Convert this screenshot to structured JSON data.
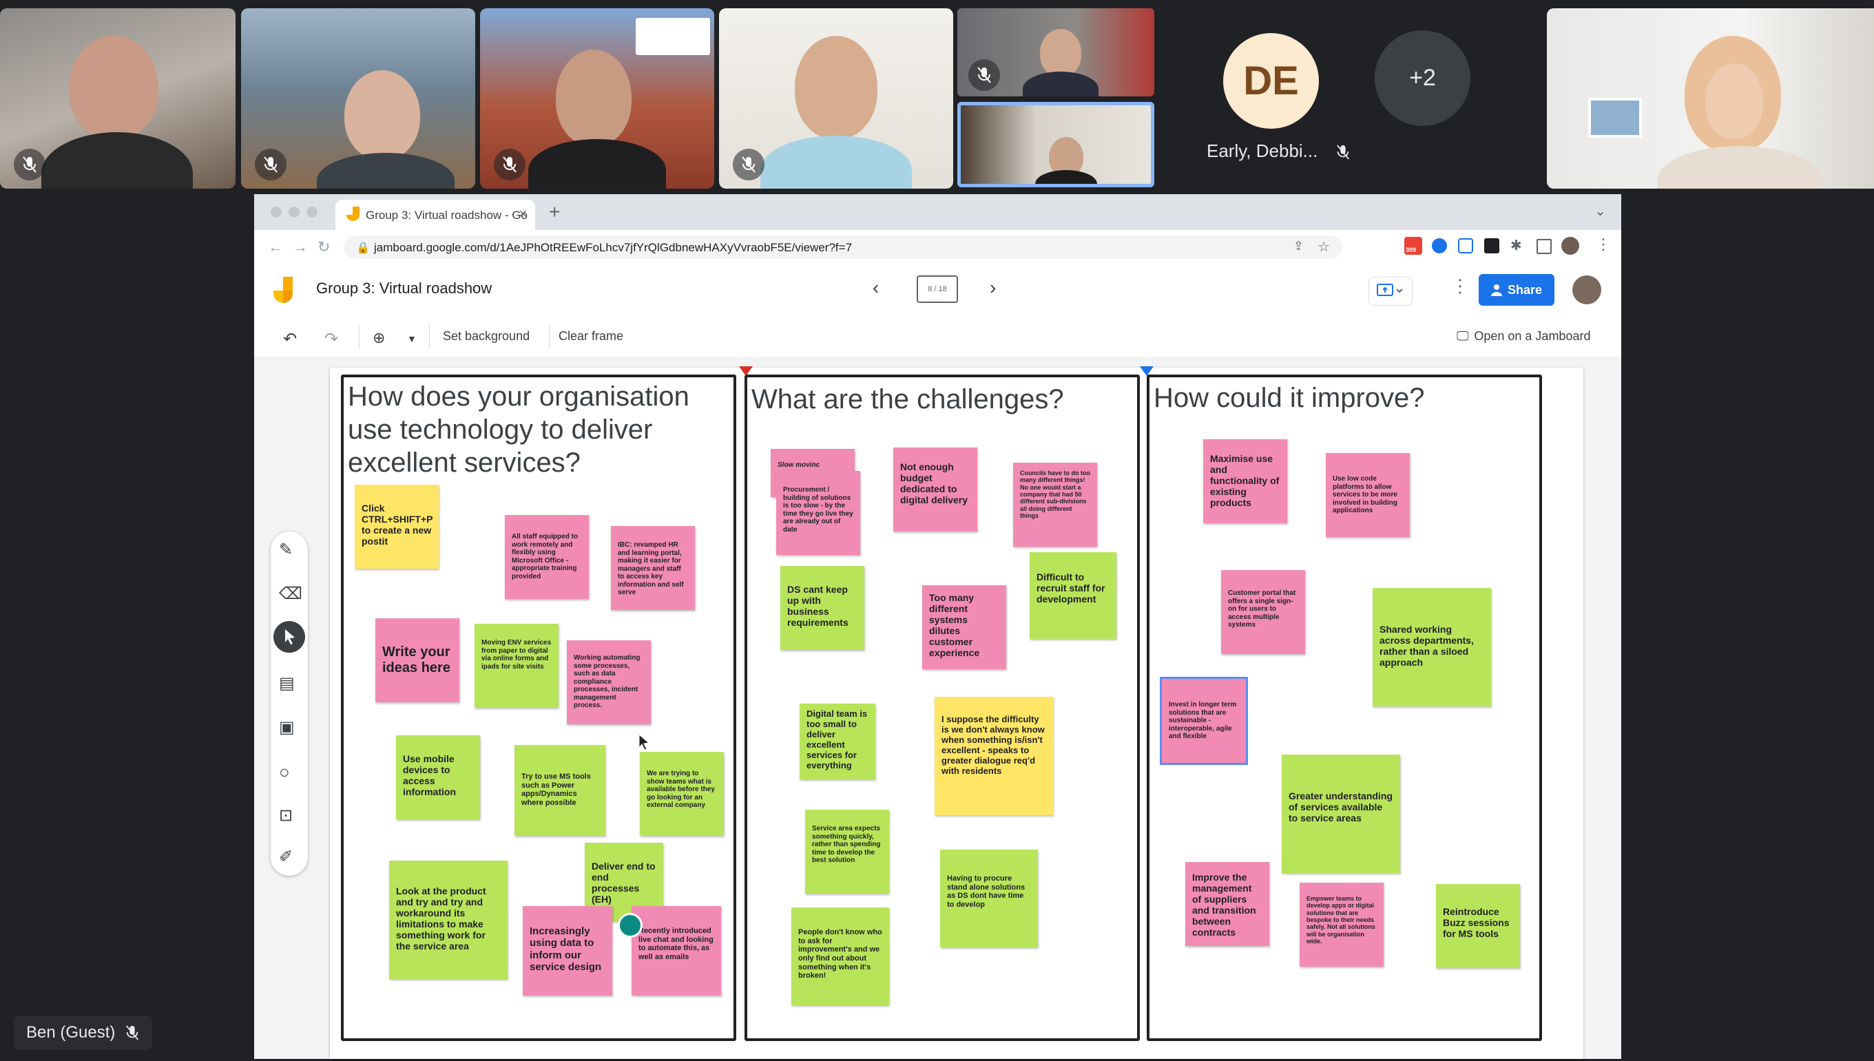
{
  "meeting": {
    "participant_name": "Early, Debbi...",
    "participant_initials": "DE",
    "more_participants": "+2",
    "self_label": "Ben (Guest)"
  },
  "browser": {
    "tab_title": "Group 3: Virtual roadshow - Go",
    "url": "jamboard.google.com/d/1AeJPhOtREEwFoLhcv7jfYrQlGdbnewHAXyVvraobF5E/viewer?f=7",
    "mail_badge": "309"
  },
  "app": {
    "title": "Group 3: Virtual roadshow",
    "frame_indicator": "8 / 18",
    "share_label": "Share",
    "toolbar": {
      "set_background": "Set background",
      "clear_frame": "Clear frame",
      "open_on_jamboard": "Open on a Jamboard"
    }
  },
  "colors": {
    "pink": "#f28bb3",
    "green": "#b8e45a",
    "yellow": "#ffe566",
    "share_blue": "#1a73e8"
  },
  "columns": [
    {
      "title": "How does your organisation use technology to deliver excellent services?",
      "notes": [
        {
          "color": "yellow",
          "text": "Click CTRL+SHIFT+P to create a new postit"
        },
        {
          "color": "pink",
          "text": "All staff equipped to work remotely and flexibly using Microsoft Office - appropriate training provided"
        },
        {
          "color": "pink",
          "text": "IBC: revamped HR and learning portal, making it easier for managers and staff to access key information and self serve"
        },
        {
          "color": "pink",
          "text": "Write your ideas here"
        },
        {
          "color": "green",
          "text": "Moving ENV services from paper to digital via online forms and ipads for site visits"
        },
        {
          "color": "pink",
          "text": "Working automating some processes, such as data compliance processes, incident management process."
        },
        {
          "color": "green",
          "text": "Use mobile devices to access information"
        },
        {
          "color": "green",
          "text": "Try to use MS tools such as Power apps/Dynamics where possible"
        },
        {
          "color": "green",
          "text": "We are trying to show teams what is available before they go looking for an external company"
        },
        {
          "color": "green",
          "text": "Deliver end to end processes (EH)"
        },
        {
          "color": "green",
          "text": "Look at the product and try and try and workaround its limitations to make something work for the service area"
        },
        {
          "color": "pink",
          "text": "Increasingly using data to inform our service design"
        },
        {
          "color": "pink",
          "text": "Recently introduced live chat and looking to automate this, as well as emails"
        }
      ]
    },
    {
      "title": "What are the challenges?",
      "notes": [
        {
          "color": "pink",
          "text": "Slow movinc"
        },
        {
          "color": "pink",
          "text": "Procurement / building of solutions is too slow - by the time they go live they are already out of date"
        },
        {
          "color": "pink",
          "text": "Not enough budget dedicated to digital delivery"
        },
        {
          "color": "pink",
          "text": "Councils have to do too many different things! No one would start a company that had 50 different sub-divisions all doing different things"
        },
        {
          "color": "green",
          "text": "DS cant keep up with business requirements"
        },
        {
          "color": "pink",
          "text": "Too many different systems dilutes customer experience"
        },
        {
          "color": "green",
          "text": "Difficult to recruit staff for development"
        },
        {
          "color": "green",
          "text": "Digital team is too small to deliver excellent services for everything"
        },
        {
          "color": "yellow",
          "text": "I suppose the difficulty is we don't always know when something is/isn't excellent - speaks to greater dialogue req'd with residents"
        },
        {
          "color": "green",
          "text": "Service area expects something quickly, rather than spending time to develop the best solution"
        },
        {
          "color": "green",
          "text": "Having to procure stand alone solutions as DS dont have time to develop"
        },
        {
          "color": "green",
          "text": "People don't know who to ask for improvement's and we only find out about something when it's broken!"
        }
      ]
    },
    {
      "title": "How could it improve?",
      "notes": [
        {
          "color": "pink",
          "text": "Maximise use and functionality of existing products"
        },
        {
          "color": "pink",
          "text": "Use low code platforms to allow services to be more involved in building applications"
        },
        {
          "color": "pink",
          "text": "Customer portal that offers a single sign-on for users to access multiple systems"
        },
        {
          "color": "green",
          "text": "Shared working across departments, rather than a siloed approach"
        },
        {
          "color": "pink",
          "text": "Invest in longer term solutions that are sustainable - interoperable, agile and flexible"
        },
        {
          "color": "green",
          "text": "Greater understanding of services available to service areas"
        },
        {
          "color": "pink",
          "text": "Improve the management of suppliers and transition between contracts"
        },
        {
          "color": "pink",
          "text": "Empower teams to develop apps or digital solutions that are bespoke to their needs safely. Not all solutions will be organisation wide."
        },
        {
          "color": "green",
          "text": "Reintroduce Buzz sessions for MS tools"
        }
      ]
    }
  ]
}
